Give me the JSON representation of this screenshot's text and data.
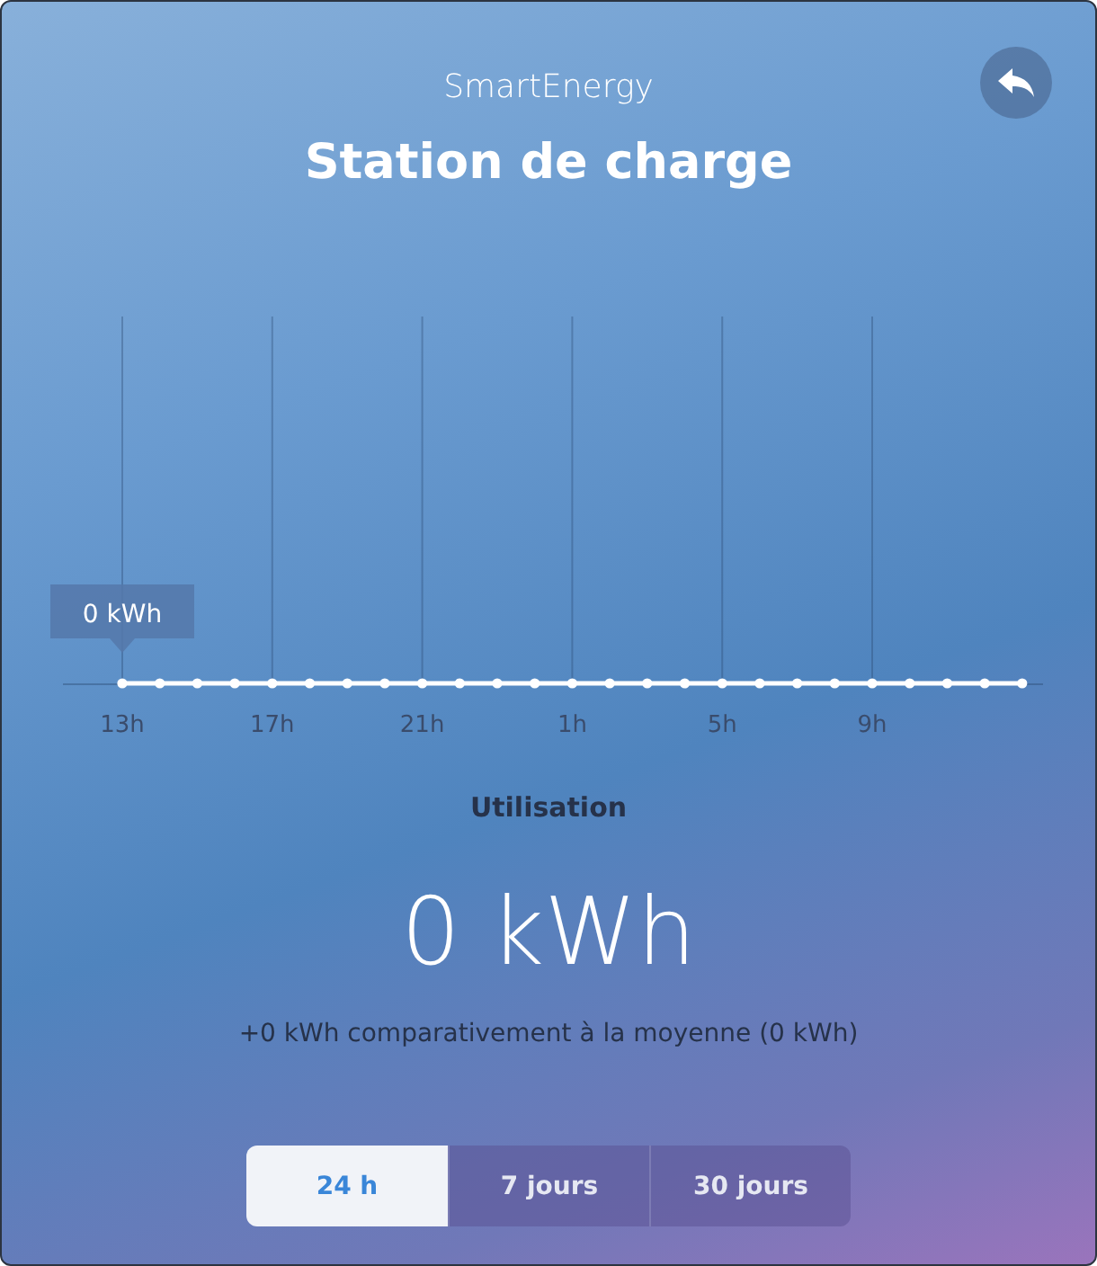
{
  "header": {
    "app_name": "SmartEnergy",
    "title": "Station de charge"
  },
  "chart": {
    "hour_labels": [
      "13h",
      "17h",
      "21h",
      "1h",
      "5h",
      "9h"
    ],
    "tooltip": "0 kWh"
  },
  "summary": {
    "label": "Utilisation",
    "value": "0 kWh",
    "comparison": "+0 kWh comparativement à la moyenne (0 kWh)"
  },
  "periods": [
    {
      "label": "24 h",
      "selected": true
    },
    {
      "label": "7 jours",
      "selected": false
    },
    {
      "label": "30 jours",
      "selected": false
    }
  ]
}
